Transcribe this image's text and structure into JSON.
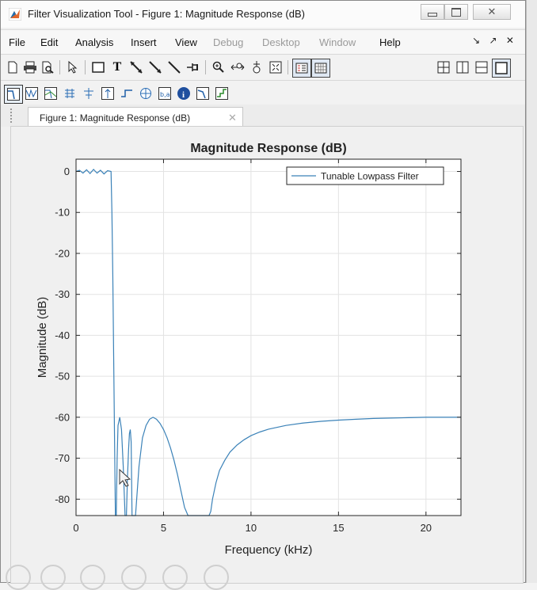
{
  "window": {
    "title": "Filter Visualization Tool - Figure 1: Magnitude Response (dB)",
    "controls": [
      "minimize",
      "maximize",
      "close"
    ]
  },
  "menu": {
    "items": [
      {
        "label": "File",
        "enabled": true
      },
      {
        "label": "Edit",
        "enabled": true
      },
      {
        "label": "Analysis",
        "enabled": true
      },
      {
        "label": "Insert",
        "enabled": true
      },
      {
        "label": "View",
        "enabled": true
      },
      {
        "label": "Debug",
        "enabled": false
      },
      {
        "label": "Desktop",
        "enabled": false
      },
      {
        "label": "Window",
        "enabled": false
      },
      {
        "label": "Help",
        "enabled": true
      }
    ],
    "right_controls": "↘ ↗ ✕"
  },
  "tab": {
    "label": "Figure 1: Magnitude Response (dB)",
    "close": "✕"
  },
  "chart_data": {
    "type": "line",
    "title": "Magnitude Response (dB)",
    "xlabel": "Frequency (kHz)",
    "ylabel": "Magnitude (dB)",
    "xlim": [
      0,
      22
    ],
    "ylim": [
      -84,
      3
    ],
    "xticks": [
      "0",
      "5",
      "10",
      "15",
      "20"
    ],
    "yticks": [
      "0",
      "-10",
      "-20",
      "-30",
      "-40",
      "-50",
      "-60",
      "-70",
      "-80"
    ],
    "grid": true,
    "legend": "top-right",
    "color": "#3b82b8",
    "series": [
      {
        "name": "Tunable Lowpass Filter",
        "x": [
          0,
          0.2,
          0.4,
          0.6,
          0.8,
          1.0,
          1.2,
          1.4,
          1.6,
          1.8,
          2.0,
          2.05,
          2.1,
          2.15,
          2.2,
          2.25,
          2.3,
          2.35,
          2.4,
          2.5,
          2.6,
          2.7,
          2.8,
          2.88,
          2.94,
          3.0,
          3.05,
          3.1,
          3.15,
          3.2,
          3.4,
          3.6,
          3.8,
          4.0,
          4.2,
          4.4,
          4.6,
          4.8,
          5.0,
          5.2,
          5.4,
          5.6,
          5.8,
          6.0,
          6.2,
          6.4,
          6.6,
          6.8,
          7.0,
          7.1,
          7.2,
          7.3,
          7.4,
          7.5,
          7.6,
          7.7,
          7.8,
          8.0,
          8.2,
          8.5,
          8.8,
          9.2,
          9.6,
          10,
          10.5,
          11,
          12,
          13,
          14,
          15,
          16,
          17,
          18,
          19,
          20,
          21,
          22
        ],
        "y": [
          0,
          0.3,
          -0.4,
          0.4,
          -0.5,
          0.5,
          -0.4,
          0.3,
          -0.6,
          0.2,
          0,
          -10,
          -25,
          -45,
          -65,
          -84,
          -84,
          -70,
          -62,
          -60,
          -63,
          -72,
          -84,
          -84,
          -75,
          -68,
          -64,
          -63,
          -66,
          -84,
          -84,
          -72,
          -65,
          -62,
          -60.5,
          -60,
          -60.5,
          -61.5,
          -63,
          -65,
          -67.5,
          -70.5,
          -74,
          -78,
          -82,
          -84,
          -84,
          -84,
          -84,
          -84,
          -84,
          -84,
          -84,
          -84,
          -84,
          -83,
          -80,
          -76,
          -73,
          -70.5,
          -68.5,
          -66.8,
          -65.5,
          -64.5,
          -63.6,
          -62.9,
          -62,
          -61.4,
          -61,
          -60.7,
          -60.5,
          -60.3,
          -60.2,
          -60.1,
          -60,
          -60,
          -60
        ]
      }
    ]
  }
}
